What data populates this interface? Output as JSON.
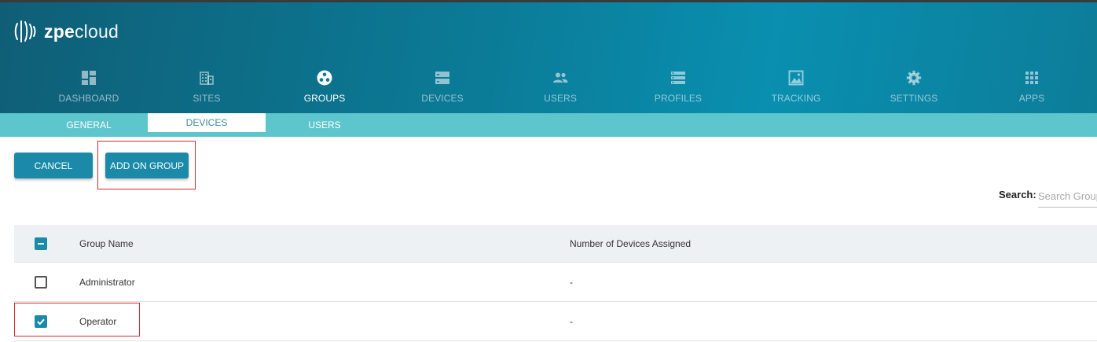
{
  "app": {
    "logo_bold": "zpe",
    "logo_light": "cloud"
  },
  "nav": [
    {
      "label": "DASHBOARD",
      "icon": "dashboard-icon",
      "active": false
    },
    {
      "label": "SITES",
      "icon": "building-icon",
      "active": false
    },
    {
      "label": "GROUPS",
      "icon": "groups-icon",
      "active": true
    },
    {
      "label": "DEVICES",
      "icon": "server-icon",
      "active": false
    },
    {
      "label": "USERS",
      "icon": "users-icon",
      "active": false
    },
    {
      "label": "PROFILES",
      "icon": "profiles-icon",
      "active": false
    },
    {
      "label": "TRACKING",
      "icon": "image-icon",
      "active": false
    },
    {
      "label": "SETTINGS",
      "icon": "gear-icon",
      "active": false
    },
    {
      "label": "APPS",
      "icon": "apps-grid-icon",
      "active": false
    }
  ],
  "subnav": [
    {
      "label": "GENERAL",
      "active": false
    },
    {
      "label": "DEVICES",
      "active": true
    },
    {
      "label": "USERS",
      "active": false
    }
  ],
  "actions": {
    "cancel_label": "CANCEL",
    "add_label": "ADD ON GROUP"
  },
  "search": {
    "label": "Search:",
    "placeholder": "Search Group"
  },
  "table": {
    "columns": [
      "Group Name",
      "Number of Devices Assigned"
    ],
    "header_checkbox": "indeterminate",
    "rows": [
      {
        "name": "Administrator",
        "devices": "-",
        "checked": false
      },
      {
        "name": "Operator",
        "devices": "-",
        "checked": true
      }
    ]
  },
  "colors": {
    "accent": "#1b8aa8",
    "subnav": "#5dc6cc",
    "highlight": "#d9282e"
  }
}
